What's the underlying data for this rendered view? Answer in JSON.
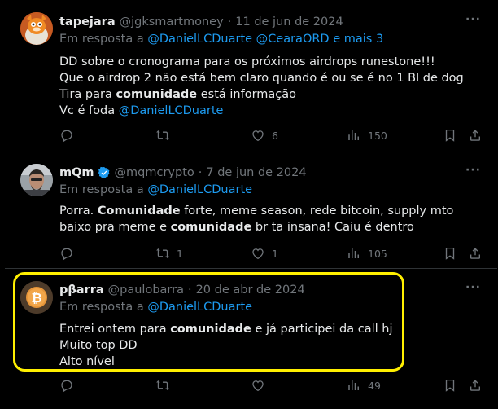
{
  "tweets": [
    {
      "name": "tapejara",
      "handle": "@jgksmartmoney",
      "sep": "·",
      "date": "11 de jun de 2024",
      "reply_prefix": "Em resposta a",
      "reply_mentions": "@DanielLCDuarte @CearaORD",
      "reply_suffix": "e mais 3",
      "lines": [
        "DD sobre o cronograma para os próximos airdrops  runestone!!!",
        "Que o airdrop 2 não está bem claro quando é ou se é no 1 Bl de dog",
        "Tira para ",
        "comunidade",
        " está informação",
        "Vc é foda ",
        "@DanielLCDuarte"
      ],
      "stats": {
        "replies": "",
        "reposts": "",
        "likes": "6",
        "views": "150"
      }
    },
    {
      "name": "mQm",
      "handle": "@mqmcrypto",
      "sep": "·",
      "date": "7 de jun de 2024",
      "reply_prefix": "Em resposta a",
      "reply_mentions": "@DanielLCDuarte",
      "text_parts": [
        "Porra. ",
        "Comunidade",
        " forte, meme season, rede bitcoin, supply mto baixo pra meme e ",
        "comunidade",
        " br ta insana! Caiu é dentro"
      ],
      "stats": {
        "replies": "",
        "reposts": "1",
        "likes": "1",
        "views": "105"
      }
    },
    {
      "name": "pβarra",
      "handle": "@paulobarra",
      "sep": "·",
      "date": "20 de abr de 2024",
      "reply_prefix": "Em resposta a",
      "reply_mentions": "@DanielLCDuarte",
      "text_parts": [
        "Entrei ontem para ",
        "comunidade",
        " e já participei da call hj",
        "Muito top DD",
        "Alto nível"
      ],
      "stats": {
        "replies": "",
        "reposts": "",
        "likes": "",
        "views": "49"
      }
    }
  ],
  "more_label": "···",
  "colors": {
    "background": "#000000",
    "text": "#e7e9ea",
    "muted": "#71767b",
    "link": "#1d9bf0",
    "highlight": "#ffef00",
    "divider": "#2f3336"
  },
  "icons": [
    "reply-icon",
    "repost-icon",
    "like-icon",
    "views-icon",
    "bookmark-icon",
    "share-icon",
    "verified-icon",
    "more-icon"
  ]
}
